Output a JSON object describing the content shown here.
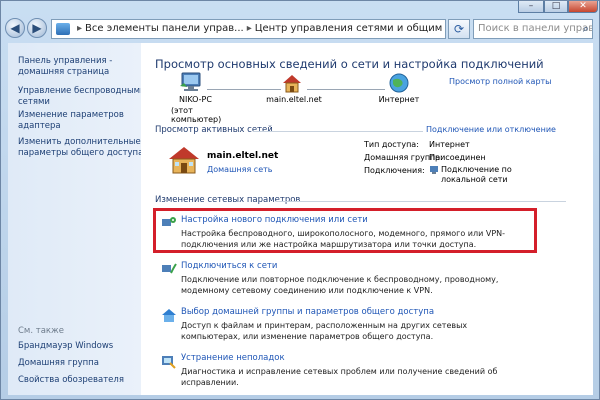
{
  "address": {
    "crumb1": "Все элементы панели управ...",
    "crumb2": "Центр управления сетями и общим доступом",
    "search_placeholder": "Поиск в панели управления"
  },
  "sidebar": {
    "items": [
      {
        "label": "Панель управления -\nдомашняя страница"
      },
      {
        "label": "Управление беспроводными\nсетями"
      },
      {
        "label": "Изменение параметров\nадаптера"
      },
      {
        "label": "Изменить дополнительные\nпараметры общего доступа"
      }
    ],
    "see_also_title": "См. также",
    "see_also": [
      {
        "label": "Брандмауэр Windows"
      },
      {
        "label": "Домашняя группа"
      },
      {
        "label": "Свойства обозревателя"
      }
    ]
  },
  "main": {
    "title": "Просмотр основных сведений о сети и настройка подключений",
    "full_map": "Просмотр полной карты",
    "map": {
      "pc_name": "NIKO-PC",
      "pc_sub": "(этот компьютер)",
      "network": "main.eltel.net",
      "internet": "Интернет"
    },
    "active_header": "Просмотр активных сетей",
    "connect_disconnect": "Подключение или отключение",
    "active_network": {
      "name": "main.eltel.net",
      "type": "Домашняя сеть",
      "access_label": "Тип доступа:",
      "access_value": "Интернет",
      "homegroup_label": "Домашняя группа:",
      "homegroup_value": "Присоединен",
      "connections_label": "Подключения:",
      "connections_value": "Подключение по\nлокальной сети"
    },
    "change_header": "Изменение сетевых параметров",
    "tasks": [
      {
        "title": "Настройка нового подключения или сети",
        "desc": "Настройка беспроводного, широкополосного, модемного, прямого или VPN-подключения или же настройка маршрутизатора или точки доступа.",
        "icon": "network-setup-icon"
      },
      {
        "title": "Подключиться к сети",
        "desc": "Подключение или повторное подключение к беспроводному, проводному, модемному сетевому соединению или подключение к VPN.",
        "icon": "network-connect-icon"
      },
      {
        "title": "Выбор домашней группы и параметров общего доступа",
        "desc": "Доступ к файлам и принтерам, расположенным на других сетевых компьютерах, или изменение параметров общего доступа.",
        "icon": "homegroup-icon"
      },
      {
        "title": "Устранение неполадок",
        "desc": "Диагностика и исправление сетевых проблем или получение сведений об исправлении.",
        "icon": "troubleshoot-icon"
      }
    ]
  },
  "colors": {
    "highlight_border": "#d41f2a",
    "link": "#1f56b6",
    "title": "#1f3a6e"
  }
}
